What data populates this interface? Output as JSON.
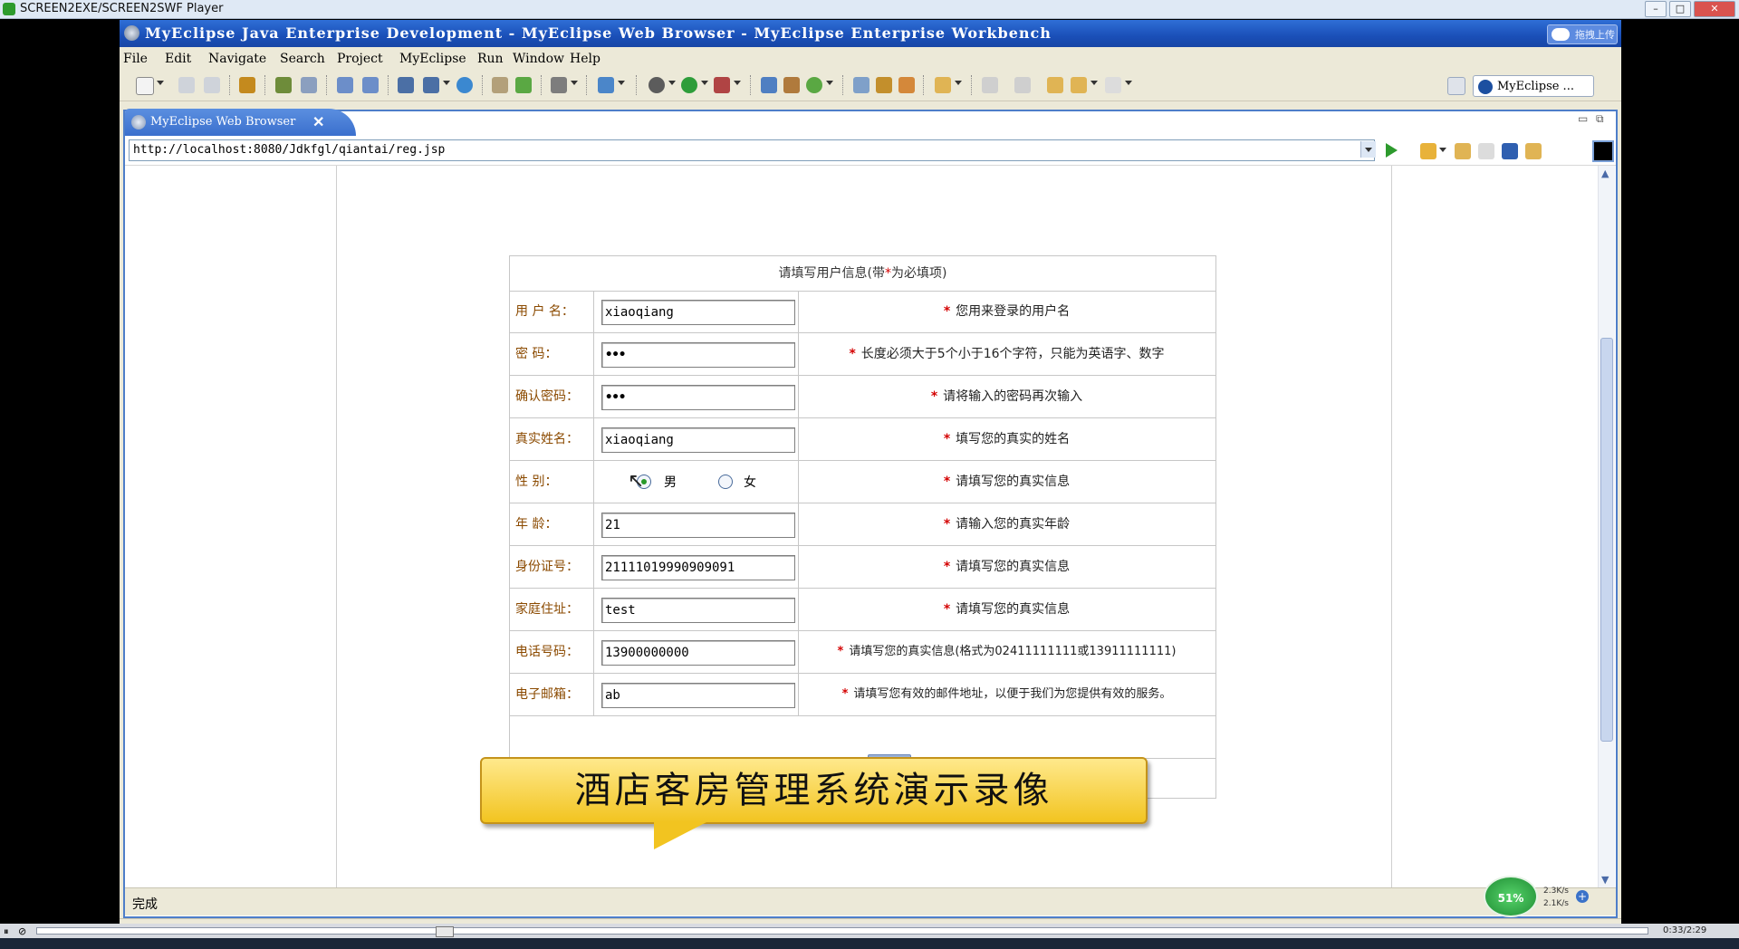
{
  "player": {
    "title": "SCREEN2EXE/SCREEN2SWF Player",
    "time": "0:33/2:29"
  },
  "ide": {
    "title": "MyEclipse Java Enterprise Development - MyEclipse Web Browser - MyEclipse Enterprise Workbench",
    "upload_label": "拖拽上传",
    "menu": [
      "File",
      "Edit",
      "Navigate",
      "Search",
      "Project",
      "MyEclipse",
      "Run",
      "Window",
      "Help"
    ],
    "perspective_label": "MyEclipse ...",
    "tab_label": "MyEclipse Web Browser",
    "tab_close": "✕",
    "status": "完成"
  },
  "browser": {
    "url": "http://localhost:8080/Jdkfgl/qiantai/reg.jsp"
  },
  "form": {
    "heading_prefix": "请填写用户信息(带",
    "heading_star": "*",
    "heading_suffix": "为必填项)",
    "req_mark": "*",
    "rows": [
      {
        "label": "用 户 名：",
        "value": "xiaoqiang",
        "hint": "您用来登录的用户名"
      },
      {
        "label": "密      码：",
        "value": "•••",
        "hint": "长度必须大于5个小于16个字符，只能为英语字、数字"
      },
      {
        "label": "确认密码：",
        "value": "•••",
        "hint": "请将输入的密码再次输入"
      },
      {
        "label": "真实姓名：",
        "value": "xiaoqiang",
        "hint": "填写您的真实的姓名"
      },
      {
        "label": "性      别：",
        "value": "",
        "hint": "请填写您的真实信息"
      },
      {
        "label": "年      龄：",
        "value": "21",
        "hint": "请输入您的真实年龄"
      },
      {
        "label": "身份证号：",
        "value": "21111019990909091",
        "hint": "请填写您的真实信息"
      },
      {
        "label": "家庭住址：",
        "value": "test",
        "hint": "请填写您的真实信息"
      },
      {
        "label": "电话号码：",
        "value": "13900000000",
        "hint": "请填写您的真实信息(格式为02411111111或13911111111)"
      },
      {
        "label": "电子邮箱：",
        "value": "ab",
        "hint": "请填写您有效的邮件地址，以便于我们为您提供有效的服务。"
      }
    ],
    "gender": {
      "male": "男",
      "female": "女",
      "selected": "男"
    }
  },
  "caption": {
    "text": "酒店客房管理系统演示录像"
  },
  "network": {
    "percent": "51%",
    "up": "2.3K/s",
    "down": "2.1K/s"
  }
}
